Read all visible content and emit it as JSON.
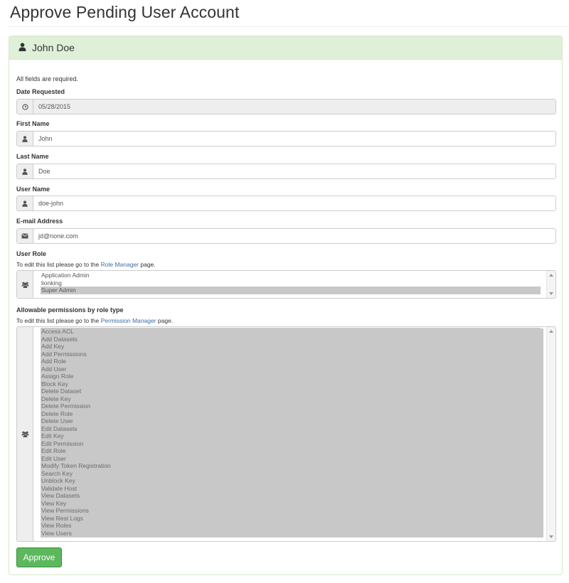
{
  "page_title": "Approve Pending User Account",
  "panel": {
    "user_name": "John Doe"
  },
  "form": {
    "required_note": "All fields are required.",
    "date_requested": {
      "label": "Date Requested",
      "value": "05/28/2015",
      "icon": "clock-icon"
    },
    "first_name": {
      "label": "First Name",
      "value": "John",
      "icon": "user-icon"
    },
    "last_name": {
      "label": "Last Name",
      "value": "Doe",
      "icon": "user-icon"
    },
    "user_name": {
      "label": "User Name",
      "value": "doe-john",
      "icon": "user-icon"
    },
    "email": {
      "label": "E-mail Address",
      "value": "jd@none.com",
      "icon": "envelope-icon"
    },
    "user_role": {
      "label": "User Role",
      "help_prefix": "To edit this list please go to the ",
      "help_link": "Role Manager",
      "help_suffix": " page.",
      "icon": "users-icon",
      "options": [
        "Application Admin",
        "lionking",
        "Super Admin"
      ],
      "selected": "Super Admin"
    },
    "permissions": {
      "label": "Allowable permissions by role type",
      "help_prefix": "To edit this list please go to the ",
      "help_link": "Permission Manager",
      "help_suffix": " page.",
      "icon": "users-icon",
      "options": [
        "Access ACL",
        "Add Datasets",
        "Add Key",
        "Add Permissions",
        "Add Role",
        "Add User",
        "Assign Role",
        "Block Key",
        "Delete Dataset",
        "Delete Key",
        "Delete Permission",
        "Delete Role",
        "Delete User",
        "Edit Datasets",
        "Edit Key",
        "Edit Permission",
        "Edit Role",
        "Edit User",
        "Modify Token Registration",
        "Search Key",
        "Unblock Key",
        "Validate Host",
        "View Datasets",
        "View Key",
        "View Permissions",
        "View Rest Logs",
        "View Roles",
        "View Users"
      ]
    },
    "approve_label": "Approve"
  },
  "colors": {
    "panel_heading_bg": "#dff0d8",
    "approve_bg": "#5cb85c",
    "selection": "#c8c8c8",
    "link": "#3a6ea5"
  }
}
